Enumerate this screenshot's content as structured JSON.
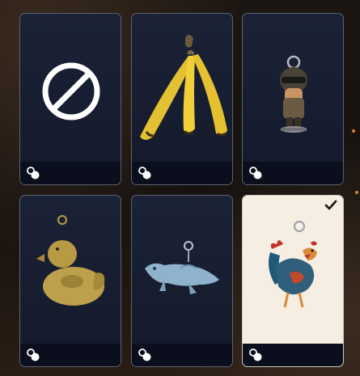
{
  "charms": {
    "items": [
      {
        "id": "none",
        "name": "none-icon",
        "selected": false
      },
      {
        "id": "bananas",
        "name": "banana-charm-icon",
        "selected": false
      },
      {
        "id": "soldier",
        "name": "soldier-figurine-charm-icon",
        "selected": false
      },
      {
        "id": "duck",
        "name": "golden-duck-charm-icon",
        "selected": false
      },
      {
        "id": "axolotl",
        "name": "blue-axolotl-charm-icon",
        "selected": false
      },
      {
        "id": "rooster",
        "name": "rooster-charm-icon",
        "selected": true
      }
    ],
    "footer_icon": "charm-ring-icon",
    "selected_icon": "checkmark-icon"
  },
  "colors": {
    "card_bg": "#1b2236",
    "card_selected_bg": "#f6ede3",
    "footer_bg": "#0b0f1d",
    "accent": "#d8821e"
  }
}
